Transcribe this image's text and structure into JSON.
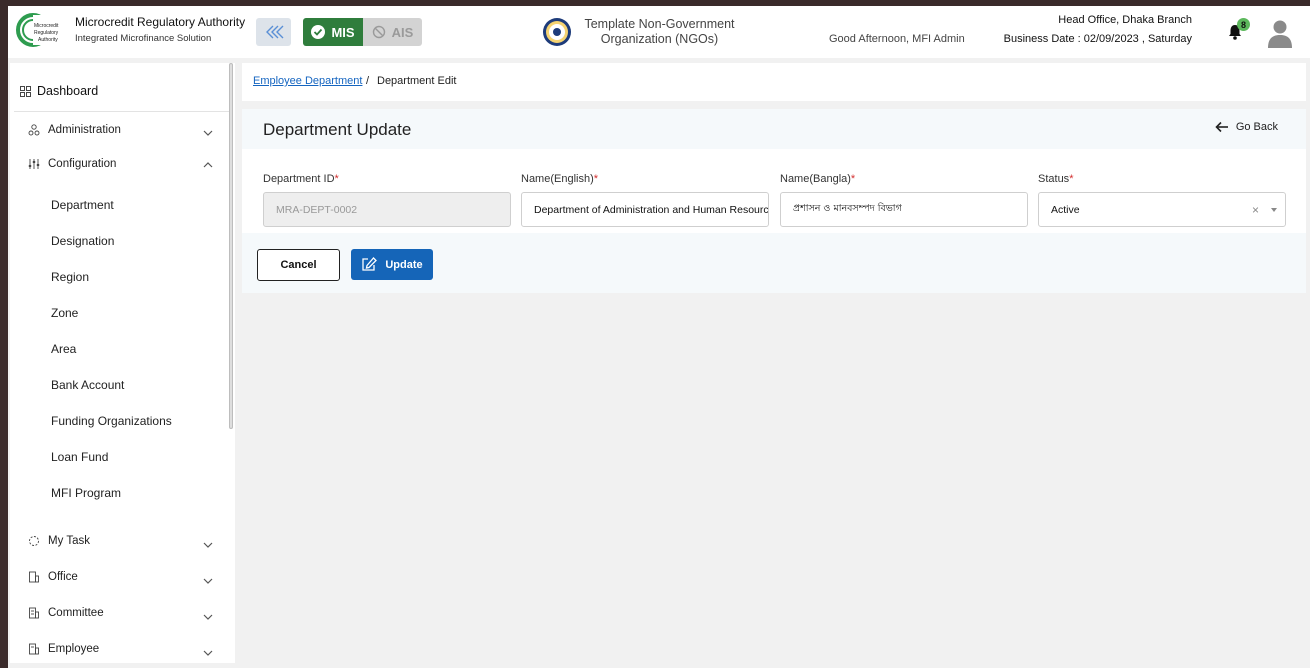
{
  "header": {
    "org_title": "Microcredit Regulatory Authority",
    "org_subtitle": "Integrated Microfinance Solution",
    "logo_text_1": "Microcredit",
    "logo_text_2": "Regulatory",
    "logo_text_3": "Authority",
    "mis_label": "MIS",
    "ais_label": "AIS",
    "ngo_name_line1": "Template Non-Government",
    "ngo_name_line2": "Organization (NGOs)",
    "greeting": "Good Afternoon, MFI Admin",
    "branch": "Head Office, Dhaka Branch",
    "business_date": "Business Date : 02/09/2023 , Saturday",
    "notification_count": "8",
    "accent_green": "#2f7d3c",
    "primary_blue": "#1565b8"
  },
  "sidebar": {
    "dashboard": "Dashboard",
    "items": [
      {
        "label": "Administration",
        "icon": "users-cog-icon",
        "expanded": false
      },
      {
        "label": "Configuration",
        "icon": "sliders-icon",
        "expanded": true
      },
      {
        "label": "My Task",
        "icon": "spinner-icon",
        "expanded": false
      },
      {
        "label": "Office",
        "icon": "building-icon",
        "expanded": false
      },
      {
        "label": "Committee",
        "icon": "committee-icon",
        "expanded": false
      },
      {
        "label": "Employee",
        "icon": "employee-icon",
        "expanded": false
      }
    ],
    "config_children": [
      "Department",
      "Designation",
      "Region",
      "Zone",
      "Area",
      "Bank Account",
      "Funding Organizations",
      "Loan Fund",
      "MFI Program"
    ]
  },
  "breadcrumb": {
    "link": "Employee Department",
    "separator": "/",
    "current": "Department Edit"
  },
  "page": {
    "title": "Department Update",
    "go_back": "Go Back"
  },
  "form": {
    "dept_id": {
      "label": "Department ID",
      "required": "*",
      "value": "MRA-DEPT-0002"
    },
    "name_en": {
      "label": "Name(English)",
      "required": "*",
      "value": "Department of Administration and Human Resources"
    },
    "name_bn": {
      "label": "Name(Bangla)",
      "required": "*",
      "value": "প্রশাসন ও মানবসম্পদ বিভাগ"
    },
    "status": {
      "label": "Status",
      "required": "*",
      "value": "Active",
      "clear": "×"
    }
  },
  "actions": {
    "cancel": "Cancel",
    "update": "Update"
  }
}
